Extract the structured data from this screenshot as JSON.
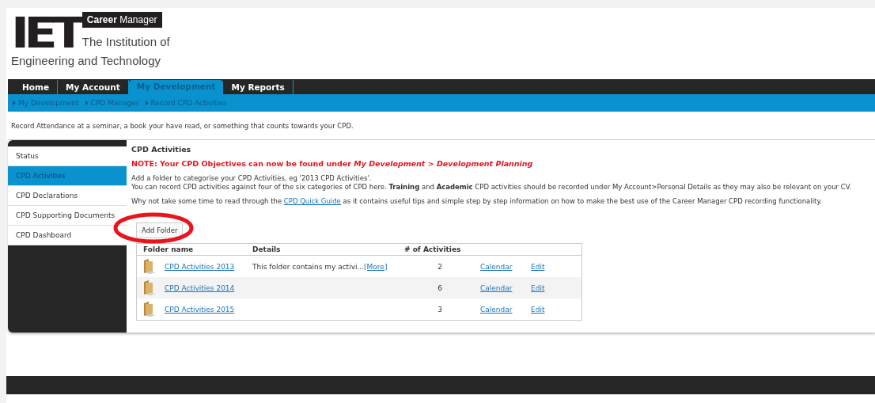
{
  "header": {
    "logo_mark": "IET",
    "product": "**Career** Manager",
    "org_line_1": "The Institution of",
    "org_line_2": "Engineering and Technology"
  },
  "nav_tabs": [
    {
      "label": "Home",
      "selected": false
    },
    {
      "label": "My Account",
      "selected": false
    },
    {
      "label": "My Development",
      "selected": true
    },
    {
      "label": "My Reports",
      "selected": false
    }
  ],
  "breadcrumbs": [
    "My Development",
    "CPD Manager",
    "Record CPD Activities"
  ],
  "intro": "Record Attendance at a seminar, a book your have read, or something that counts towards your CPD.",
  "sidebar": {
    "items": [
      {
        "label": "Status",
        "selected": false
      },
      {
        "label": "CPD Activities",
        "selected": true
      },
      {
        "label": "CPD Declarations",
        "selected": false
      },
      {
        "label": "CPD Supporting Documents",
        "selected": false
      },
      {
        "label": "CPD Dashboard",
        "selected": false
      }
    ]
  },
  "content": {
    "title": "CPD Activities",
    "note": "NOTE: Your CPD Objectives can now be found under *My Development > Development Planning*",
    "paragraph_lines": [
      "Add a folder to categorise your CPD Activities, eg '2013 CPD Activities'.",
      "You can record CPD activities against four of the six categories of CPD here. **Training** and **Academic** CPD activities should be recorded under My Account>Personal Details as they may also be relevant on your CV."
    ],
    "guide": {
      "before": "Why not take some time to read through the",
      "link": "CPD Quick Guide",
      "after": "as it contains useful tips and simple step by step information on how to make the best use of the Career Manager CPD recording functionality."
    },
    "add_button": "Add Folder",
    "table": {
      "columns": [
        "Folder name",
        "Details",
        "# of Activities"
      ],
      "rows": [
        {
          "name": "CPD Activities 2013",
          "details": "This folder contains my activi...",
          "more": "[More]",
          "count": "2",
          "calendar": "Calendar",
          "edit": "Edit"
        },
        {
          "name": "CPD Activities 2014",
          "count": "6",
          "calendar": "Calendar",
          "edit": "Edit"
        },
        {
          "name": "CPD Activities 2015",
          "count": "3",
          "calendar": "Calendar",
          "edit": "Edit"
        }
      ]
    }
  }
}
